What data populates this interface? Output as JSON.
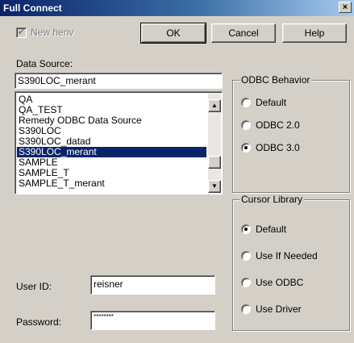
{
  "window": {
    "title": "Full Connect",
    "close_glyph": "×"
  },
  "new_henv": {
    "label": "New henv",
    "checked": "✔"
  },
  "buttons": {
    "ok": "OK",
    "cancel": "Cancel",
    "help": "Help"
  },
  "data_source": {
    "label": "Data Source:",
    "value": "S390LOC_merant",
    "items": [
      "QA",
      "QA_TEST",
      "Remedy ODBC Data Source",
      "S390LOC",
      "S390LOC_datad",
      "S390LOC_merant",
      "SAMPLE",
      "SAMPLE_T",
      "SAMPLE_T_merant"
    ],
    "selected_index": 5
  },
  "odbc_behavior": {
    "title": "ODBC Behavior",
    "options": [
      "Default",
      "ODBC 2.0",
      "ODBC 3.0"
    ],
    "selected_index": 2
  },
  "cursor_library": {
    "title": "Cursor Library",
    "options": [
      "Default",
      "Use If Needed",
      "Use ODBC",
      "Use Driver"
    ],
    "selected_index": 0
  },
  "user_id": {
    "label": "User ID:",
    "value": "reisner"
  },
  "password": {
    "label": "Password:",
    "value": "********"
  },
  "icons": {
    "scroll_up": "up-arrow-icon",
    "scroll_down": "down-arrow-icon"
  }
}
